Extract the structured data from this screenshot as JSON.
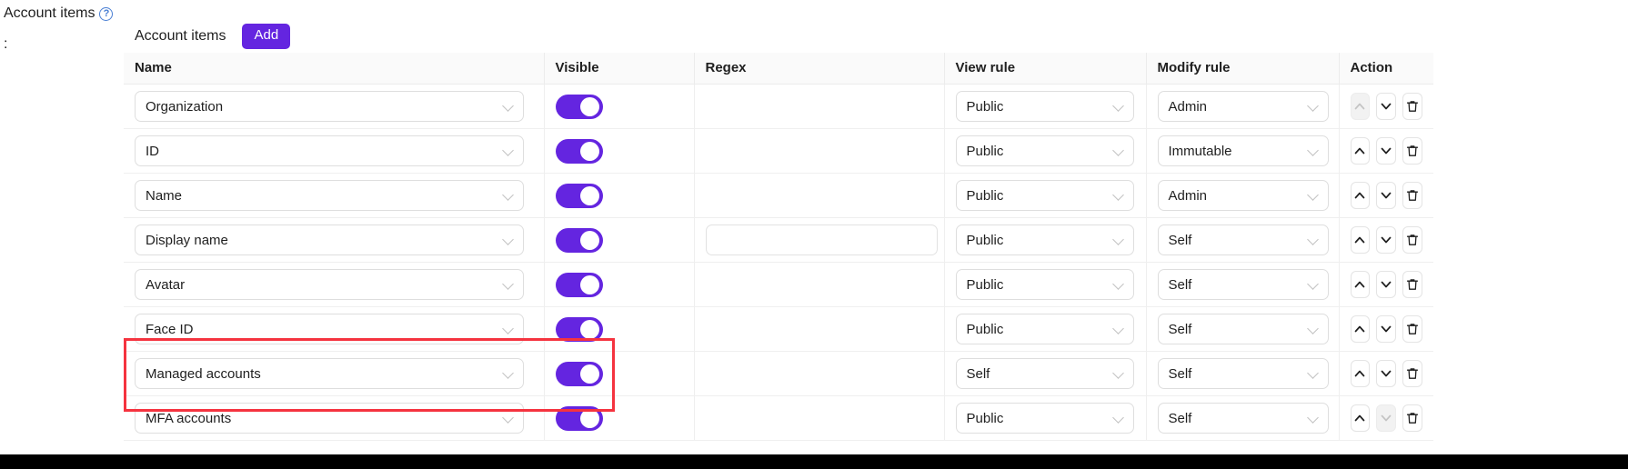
{
  "left_label": {
    "title": "Account items",
    "help_icon": "question-circle-icon",
    "colon": ":"
  },
  "toolbar": {
    "title": "Account items",
    "add_label": "Add"
  },
  "table": {
    "headers": [
      "Name",
      "Visible",
      "Regex",
      "View rule",
      "Modify rule",
      "Action"
    ],
    "rows": [
      {
        "name": "Organization",
        "visible": true,
        "regex": null,
        "regex_input": false,
        "view_rule": "Public",
        "modify_rule": "Admin",
        "up_enabled": false,
        "down_enabled": true
      },
      {
        "name": "ID",
        "visible": true,
        "regex": null,
        "regex_input": false,
        "view_rule": "Public",
        "modify_rule": "Immutable",
        "up_enabled": true,
        "down_enabled": true
      },
      {
        "name": "Name",
        "visible": true,
        "regex": null,
        "regex_input": false,
        "view_rule": "Public",
        "modify_rule": "Admin",
        "up_enabled": true,
        "down_enabled": true
      },
      {
        "name": "Display name",
        "visible": true,
        "regex": "",
        "regex_input": true,
        "view_rule": "Public",
        "modify_rule": "Self",
        "up_enabled": true,
        "down_enabled": true
      },
      {
        "name": "Avatar",
        "visible": true,
        "regex": null,
        "regex_input": false,
        "view_rule": "Public",
        "modify_rule": "Self",
        "up_enabled": true,
        "down_enabled": true
      },
      {
        "name": "Face ID",
        "visible": true,
        "regex": null,
        "regex_input": false,
        "view_rule": "Public",
        "modify_rule": "Self",
        "up_enabled": true,
        "down_enabled": true
      },
      {
        "name": "Managed accounts",
        "visible": true,
        "regex": null,
        "regex_input": false,
        "view_rule": "Self",
        "modify_rule": "Self",
        "up_enabled": true,
        "down_enabled": true
      },
      {
        "name": "MFA accounts",
        "visible": true,
        "regex": null,
        "regex_input": false,
        "view_rule": "Public",
        "modify_rule": "Self",
        "up_enabled": true,
        "down_enabled": false
      }
    ]
  },
  "icons": {
    "move_up": "chevron-up-icon",
    "move_down": "chevron-down-icon",
    "delete": "trash-icon"
  },
  "annotation": {
    "highlight_color": "#f5333f",
    "bar_color": "#000000"
  }
}
